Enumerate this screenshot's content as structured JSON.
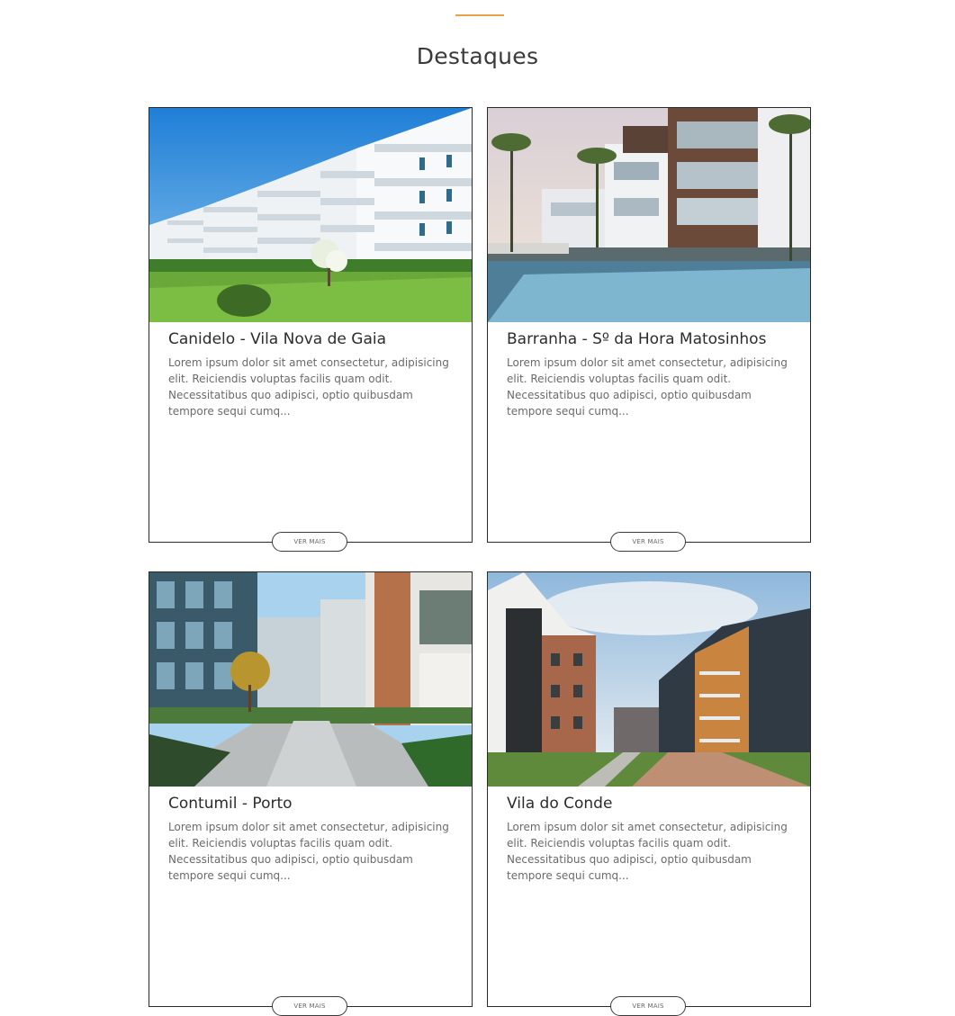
{
  "section": {
    "title": "Destaques"
  },
  "cards": [
    {
      "title": "Canidelo - Vila Nova de Gaia",
      "description": "Lorem ipsum dolor sit amet consectetur, adipisicing elit. Reiciendis voluptas facilis quam odit. Necessitatibus quo adipisci, optio quibusdam tempore sequi cumq...",
      "button_label": "VER MAIS"
    },
    {
      "title": "Barranha - Sº da Hora Matosinhos",
      "description": "Lorem ipsum dolor sit amet consectetur, adipisicing elit. Reiciendis voluptas facilis quam odit. Necessitatibus quo adipisci, optio quibusdam tempore sequi cumq...",
      "button_label": "VER MAIS"
    },
    {
      "title": "Contumil - Porto",
      "description": "Lorem ipsum dolor sit amet consectetur, adipisicing elit. Reiciendis voluptas facilis quam odit. Necessitatibus quo adipisci, optio quibusdam tempore sequi cumq...",
      "button_label": "VER MAIS"
    },
    {
      "title": "Vila do Conde",
      "description": "Lorem ipsum dolor sit amet consectetur, adipisicing elit. Reiciendis voluptas facilis quam odit. Necessitatibus quo adipisci, optio quibusdam tempore sequi cumq...",
      "button_label": "VER MAIS"
    }
  ],
  "colors": {
    "accent": "#e8a04a",
    "card_border": "#2b2b2b",
    "text_muted": "#6a6a6a"
  }
}
